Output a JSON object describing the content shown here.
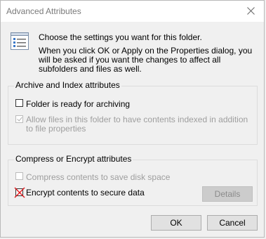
{
  "window": {
    "title": "Advanced Attributes",
    "close_icon": "close-icon"
  },
  "intro": {
    "icon": "attributes-list-icon",
    "main": "Choose the settings you want for this folder.",
    "sub": "When you click OK or Apply on the Properties dialog, you will be asked if you want the changes to affect all subfolders and files as well."
  },
  "archive_group": {
    "label": "Archive and Index attributes",
    "ready_archiving": {
      "label": "Folder is ready for archiving",
      "checked": false,
      "enabled": true
    },
    "allow_index": {
      "label": "Allow files in this folder to have contents indexed in addition to file properties",
      "checked": true,
      "enabled": false
    }
  },
  "compress_group": {
    "label": "Compress or Encrypt attributes",
    "compress": {
      "label": "Compress contents to save disk space",
      "checked": false,
      "enabled": false
    },
    "encrypt": {
      "label": "Encrypt contents to secure data",
      "checked": false,
      "enabled": true,
      "annotation_color": "#e0181c"
    },
    "details_label": "Details"
  },
  "buttons": {
    "ok_label": "OK",
    "cancel_label": "Cancel"
  }
}
